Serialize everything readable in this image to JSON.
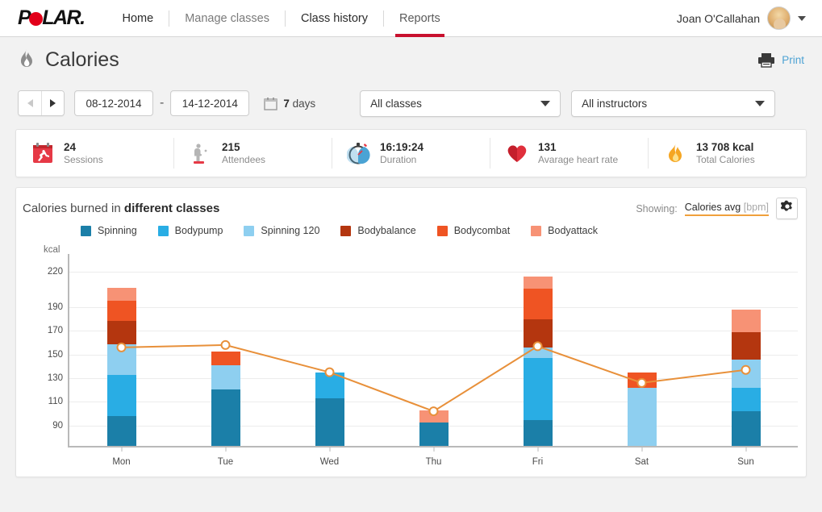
{
  "nav": {
    "logo_text_1": "P",
    "logo_text_2": "LAR.",
    "items": [
      {
        "label": "Home",
        "state": "dark"
      },
      {
        "label": "Manage classes",
        "state": "muted"
      },
      {
        "label": "Class history",
        "state": "dark"
      },
      {
        "label": "Reports",
        "state": "active"
      }
    ],
    "user_name": "Joan O'Callahan"
  },
  "page": {
    "title": "Calories",
    "title_icon": "flame-icon",
    "print_label": "Print",
    "print_icon": "printer-icon"
  },
  "filters": {
    "prev_label": "◀",
    "next_label": "▶",
    "date_from": "08-12-2014",
    "date_from_placeholder": "dd-mm-yyyy",
    "date_to": "14-12-2014",
    "date_to_placeholder": "dd-mm-yyyy",
    "dash": "-",
    "calendar_icon": "calendar-icon",
    "days_value": "7",
    "days_unit": "days",
    "class_filter": "All classes",
    "instructor_filter": "All instructors"
  },
  "stats": [
    {
      "icon": "calendar-runner-icon",
      "value": "24",
      "label": "Sessions"
    },
    {
      "icon": "attendee-icon",
      "value": "215",
      "label": "Attendees"
    },
    {
      "icon": "stopwatch-icon",
      "value": "16:19:24",
      "label": "Duration"
    },
    {
      "icon": "heart-icon",
      "value": "131",
      "label": "Avarage heart rate"
    },
    {
      "icon": "flame-icon",
      "value": "13 708 kcal",
      "label": "Total Calories"
    }
  ],
  "chart_panel": {
    "title_regular": "Calories burned in ",
    "title_bold": "different classes",
    "showing_label": "Showing:",
    "showing_value": "Calories avg ",
    "showing_unit": "[bpm]",
    "gear_icon": "gear-icon",
    "underline_color": "#f0a03c"
  },
  "chart_data": {
    "type": "bar",
    "stacked": true,
    "title": "Calories burned in different classes",
    "xlabel": "",
    "ylabel": "kcal",
    "categories": [
      "Mon",
      "Tue",
      "Wed",
      "Thu",
      "Fri",
      "Sat",
      "Sun"
    ],
    "yticks": [
      220,
      190,
      170,
      150,
      130,
      110,
      90
    ],
    "ylim": [
      70,
      235
    ],
    "grid": true,
    "legend_position": "top",
    "series": [
      {
        "name": "Spinning",
        "color": "#1b7fa8",
        "values": [
          25,
          48,
          40,
          20,
          22,
          0,
          29
        ]
      },
      {
        "name": "Bodypump",
        "color": "#29ade4",
        "values": [
          35,
          0,
          22,
          0,
          52,
          0,
          20
        ]
      },
      {
        "name": "Spinning 120",
        "color": "#8ecff0",
        "values": [
          26,
          20,
          0,
          0,
          9,
          49,
          24
        ]
      },
      {
        "name": "Bodybalance",
        "color": "#b4360f",
        "values": [
          20,
          0,
          0,
          0,
          24,
          0,
          23
        ]
      },
      {
        "name": "Bodycombat",
        "color": "#ef5423",
        "values": [
          17,
          12,
          0,
          0,
          26,
          13,
          0
        ]
      },
      {
        "name": "Bodyattack",
        "color": "#f79275",
        "values": [
          11,
          0,
          0,
          10,
          10,
          0,
          19
        ]
      }
    ],
    "overlay_line": {
      "name": "Calories avg",
      "color": "#e8903a",
      "marker_fill": "#ffffff",
      "values": [
        156,
        158,
        135,
        102,
        157,
        126,
        137
      ]
    }
  }
}
